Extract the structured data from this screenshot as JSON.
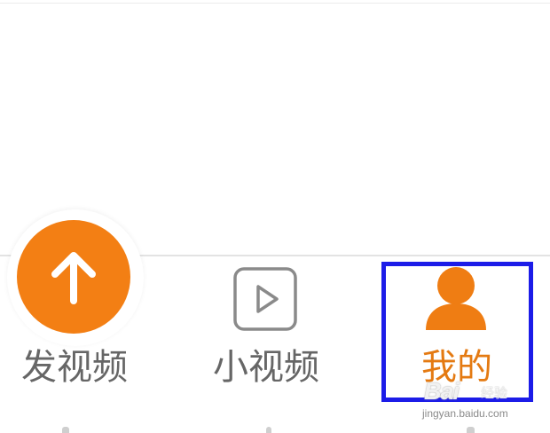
{
  "tabbar": {
    "publish_label": "发视频",
    "short_video_label": "小视频",
    "mine_label": "我的"
  },
  "watermark": {
    "brand": "Bai",
    "brand_sub": "经验",
    "url": "jingyan.baidu.com"
  },
  "icons": {
    "upload": "arrow-up-icon",
    "short_video": "play-icon",
    "mine": "person-icon"
  },
  "colors": {
    "accent": "#f37f14",
    "active_label": "#e47a12",
    "inactive": "#666666",
    "highlight_border": "#1c1ce8"
  }
}
